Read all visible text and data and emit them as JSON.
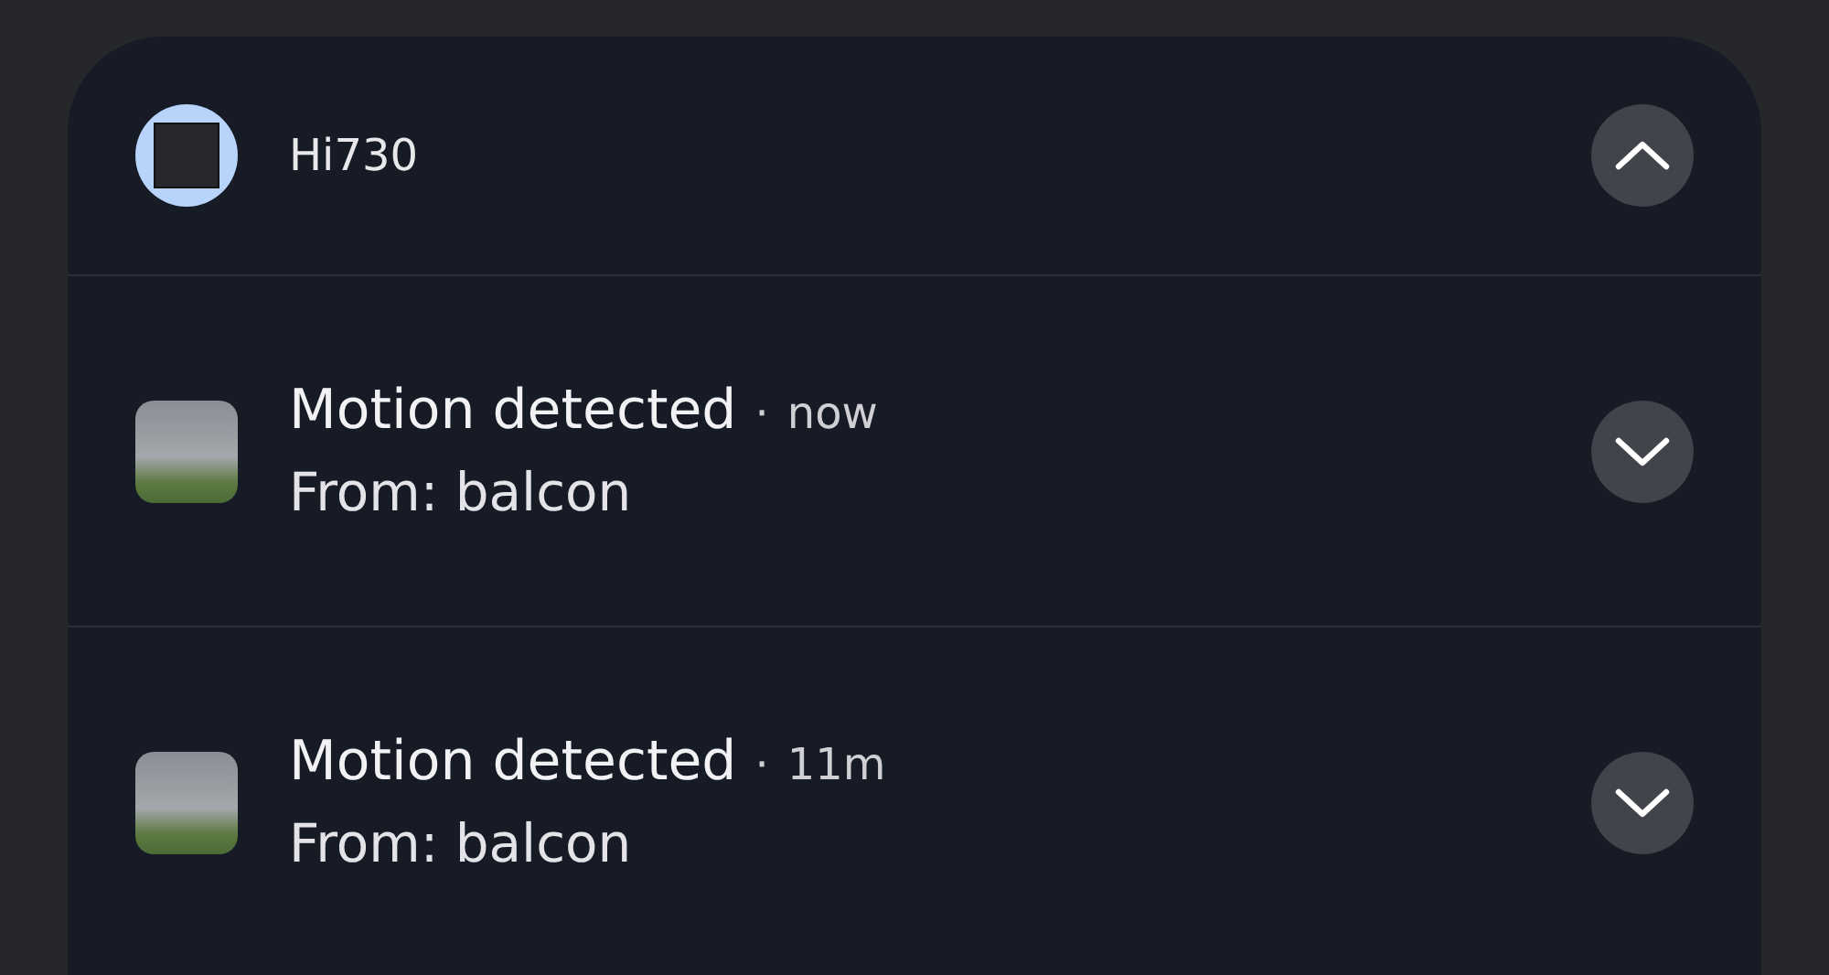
{
  "group": {
    "app_name": "Hi730",
    "expanded": true
  },
  "notifications": [
    {
      "title": "Motion detected",
      "separator": "·",
      "time": "now",
      "body": "From: balcon",
      "expanded": false
    },
    {
      "title": "Motion detected",
      "separator": "·",
      "time": "11m",
      "body": "From: balcon",
      "expanded": false
    }
  ]
}
